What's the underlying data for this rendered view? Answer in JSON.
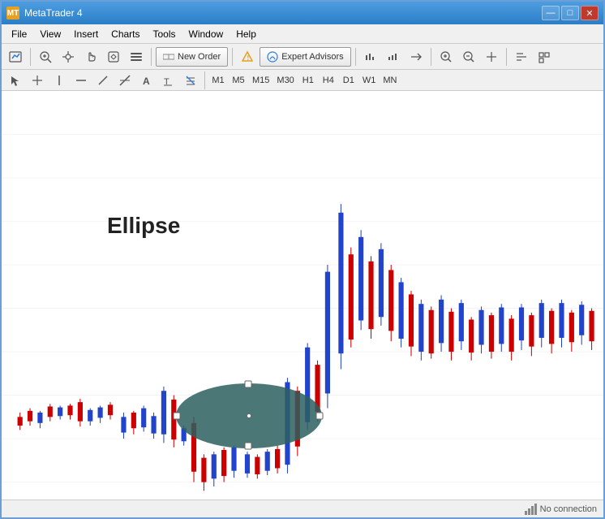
{
  "window": {
    "title": "MetaTrader 4",
    "icon": "MT"
  },
  "titlebar": {
    "buttons": {
      "minimize": "—",
      "maximize": "□",
      "close": "✕"
    }
  },
  "menu": {
    "items": [
      "File",
      "View",
      "Insert",
      "Charts",
      "Tools",
      "Window",
      "Help"
    ]
  },
  "toolbar1": {
    "new_order": "New Order",
    "expert_advisors": "Expert Advisors"
  },
  "toolbar2": {
    "timeframes": [
      "M1",
      "M5",
      "M15",
      "M30",
      "H1",
      "H4",
      "D1",
      "W1",
      "MN"
    ]
  },
  "chart": {
    "ellipse_label": "Ellipse"
  },
  "statusbar": {
    "no_connection": "No connection"
  }
}
